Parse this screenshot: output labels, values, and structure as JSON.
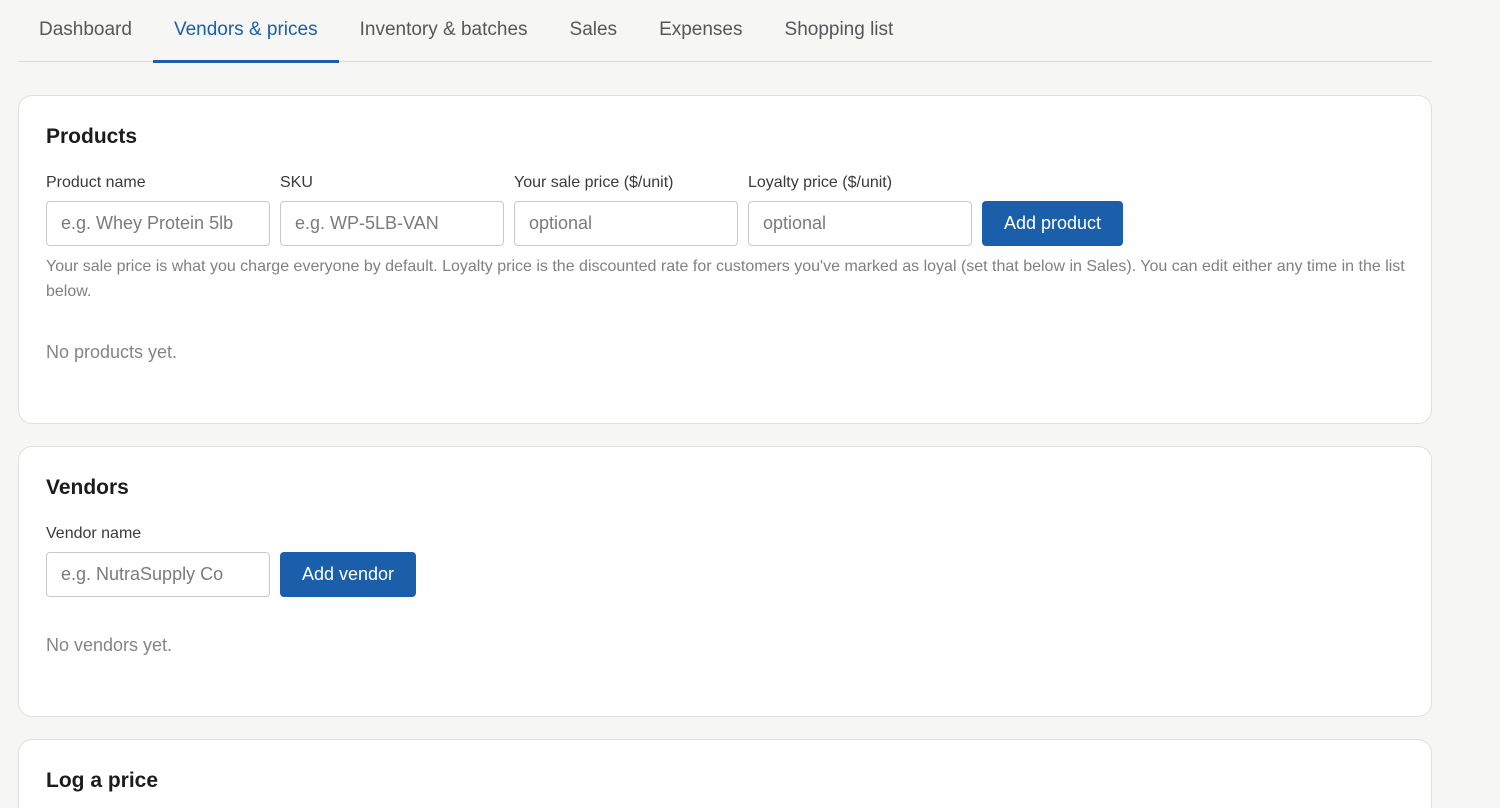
{
  "tabs": [
    {
      "label": "Dashboard"
    },
    {
      "label": "Vendors & prices"
    },
    {
      "label": "Inventory & batches"
    },
    {
      "label": "Sales"
    },
    {
      "label": "Expenses"
    },
    {
      "label": "Shopping list"
    }
  ],
  "active_tab": "Vendors & prices",
  "products": {
    "title": "Products",
    "fields": {
      "name": {
        "label": "Product name",
        "placeholder": "e.g. Whey Protein 5lb",
        "value": ""
      },
      "sku": {
        "label": "SKU",
        "placeholder": "e.g. WP-5LB-VAN",
        "value": ""
      },
      "sale_price": {
        "label": "Your sale price ($/unit)",
        "placeholder": "optional",
        "value": ""
      },
      "loyalty_price": {
        "label": "Loyalty price ($/unit)",
        "placeholder": "optional",
        "value": ""
      }
    },
    "add_button": "Add product",
    "help_text": "Your sale price is what you charge everyone by default. Loyalty price is the discounted rate for customers you've marked as loyal (set that below in Sales). You can edit either any time in the list below.",
    "empty_text": "No products yet."
  },
  "vendors": {
    "title": "Vendors",
    "fields": {
      "name": {
        "label": "Vendor name",
        "placeholder": "e.g. NutraSupply Co",
        "value": ""
      }
    },
    "add_button": "Add vendor",
    "empty_text": "No vendors yet."
  },
  "log_price": {
    "title": "Log a price"
  },
  "colors": {
    "accent": "#1b5faa",
    "background": "#f6f6f4",
    "card": "#ffffff"
  }
}
